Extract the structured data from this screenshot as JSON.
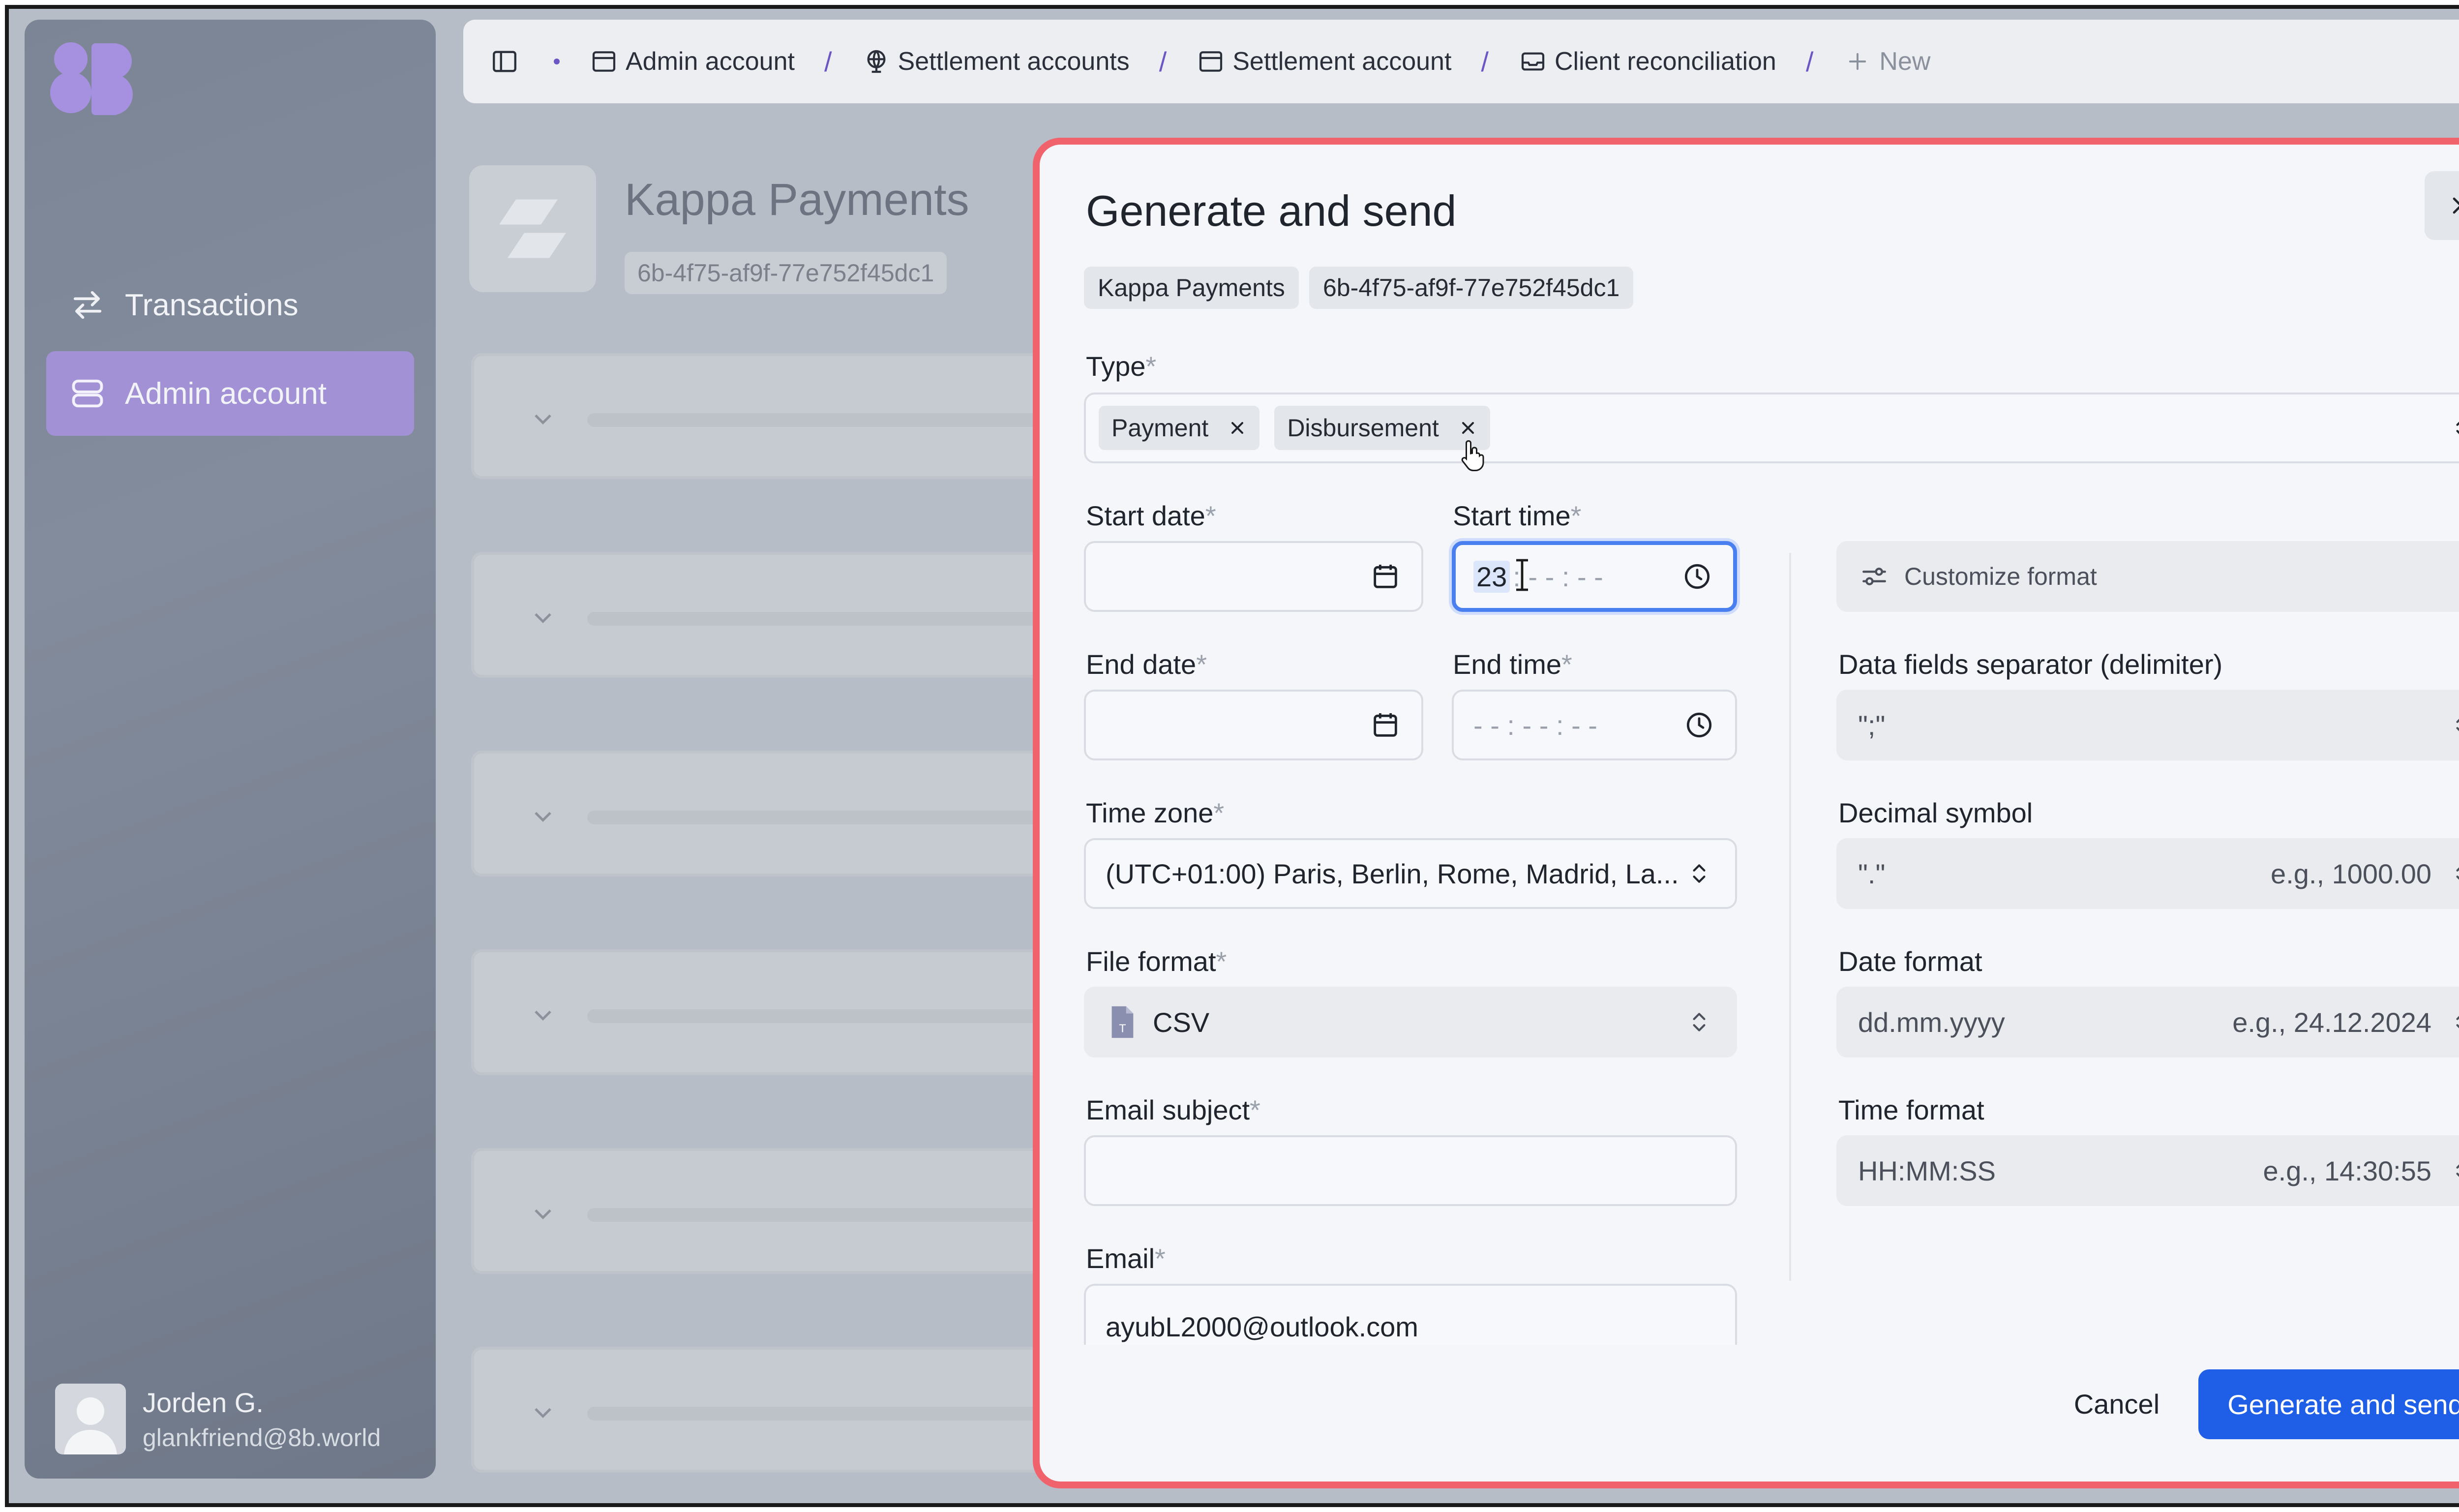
{
  "sidebar": {
    "items": [
      {
        "label": "Transactions",
        "icon": "arrows-swap-icon"
      },
      {
        "label": "Admin account",
        "icon": "database-icon"
      }
    ],
    "user": {
      "name": "Jorden G.",
      "email": "glankfriend@8b.world"
    }
  },
  "breadcrumbs": [
    {
      "label": "Admin account",
      "icon": "window-icon"
    },
    {
      "label": "Settlement accounts",
      "icon": "globe-icon"
    },
    {
      "label": "Settlement account",
      "icon": "window-icon"
    },
    {
      "label": "Client reconciliation",
      "icon": "inbox-icon"
    },
    {
      "label": "New",
      "icon": "plus-icon"
    }
  ],
  "page": {
    "title": "Kappa Payments",
    "id": "6b-4f75-af9f-77e752f45dc1"
  },
  "modal": {
    "title": "Generate and send",
    "chips": [
      "Kappa Payments",
      "6b-4f75-af9f-77e752f45dc1"
    ],
    "type": {
      "label": "Type",
      "tags": [
        "Payment",
        "Disbursement"
      ]
    },
    "start_date": {
      "label": "Start date",
      "value": ""
    },
    "start_time": {
      "label": "Start time",
      "hours": "23",
      "rest": ": - - : - -"
    },
    "end_date": {
      "label": "End date",
      "value": ""
    },
    "end_time": {
      "label": "End time",
      "placeholder": "- - : - - : - -"
    },
    "time_zone": {
      "label": "Time zone",
      "value": "(UTC+01:00) Paris, Berlin, Rome, Madrid, La..."
    },
    "file_format": {
      "label": "File format",
      "value": "CSV"
    },
    "email_subject": {
      "label": "Email subject",
      "value": ""
    },
    "email": {
      "label": "Email",
      "value": "ayubL2000@outlook.com"
    },
    "customize_format": {
      "label": "Customize format"
    },
    "delimiter": {
      "label": "Data fields separator (delimiter)",
      "value": "\";\""
    },
    "decimal": {
      "label": "Decimal symbol",
      "value": "\".\"",
      "hint": "e.g., 1000.00"
    },
    "date_format": {
      "label": "Date format",
      "value": "dd.mm.yyyy",
      "hint": "e.g., 24.12.2024"
    },
    "time_format": {
      "label": "Time format",
      "value": "HH:MM:SS",
      "hint": "e.g., 14:30:55"
    },
    "required_mark": "*",
    "cancel_label": "Cancel",
    "submit_label": "Generate and send"
  },
  "colors": {
    "accent": "#a391d6",
    "primary": "#1f5fe8",
    "highlight_border": "#f0626c",
    "focus": "#4a7ff0"
  }
}
